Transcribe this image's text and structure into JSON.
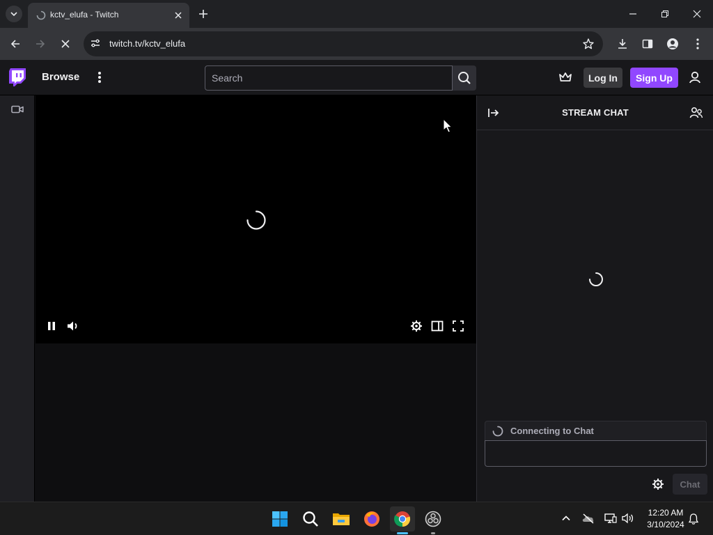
{
  "browser": {
    "tab_title": "kctv_elufa - Twitch",
    "url": "twitch.tv/kctv_elufa"
  },
  "twitch_nav": {
    "browse_label": "Browse",
    "search_placeholder": "Search",
    "login_label": "Log In",
    "signup_label": "Sign Up",
    "accent_color": "#9147ff"
  },
  "chat": {
    "title": "STREAM CHAT",
    "status_text": "Connecting to Chat",
    "send_label": "Chat"
  },
  "taskbar": {
    "apps": [
      "start-icon",
      "search-icon",
      "file-explorer-icon",
      "firefox-icon",
      "chrome-icon",
      "obs-icon"
    ],
    "time": "12:20 AM",
    "date": "3/10/2024"
  }
}
